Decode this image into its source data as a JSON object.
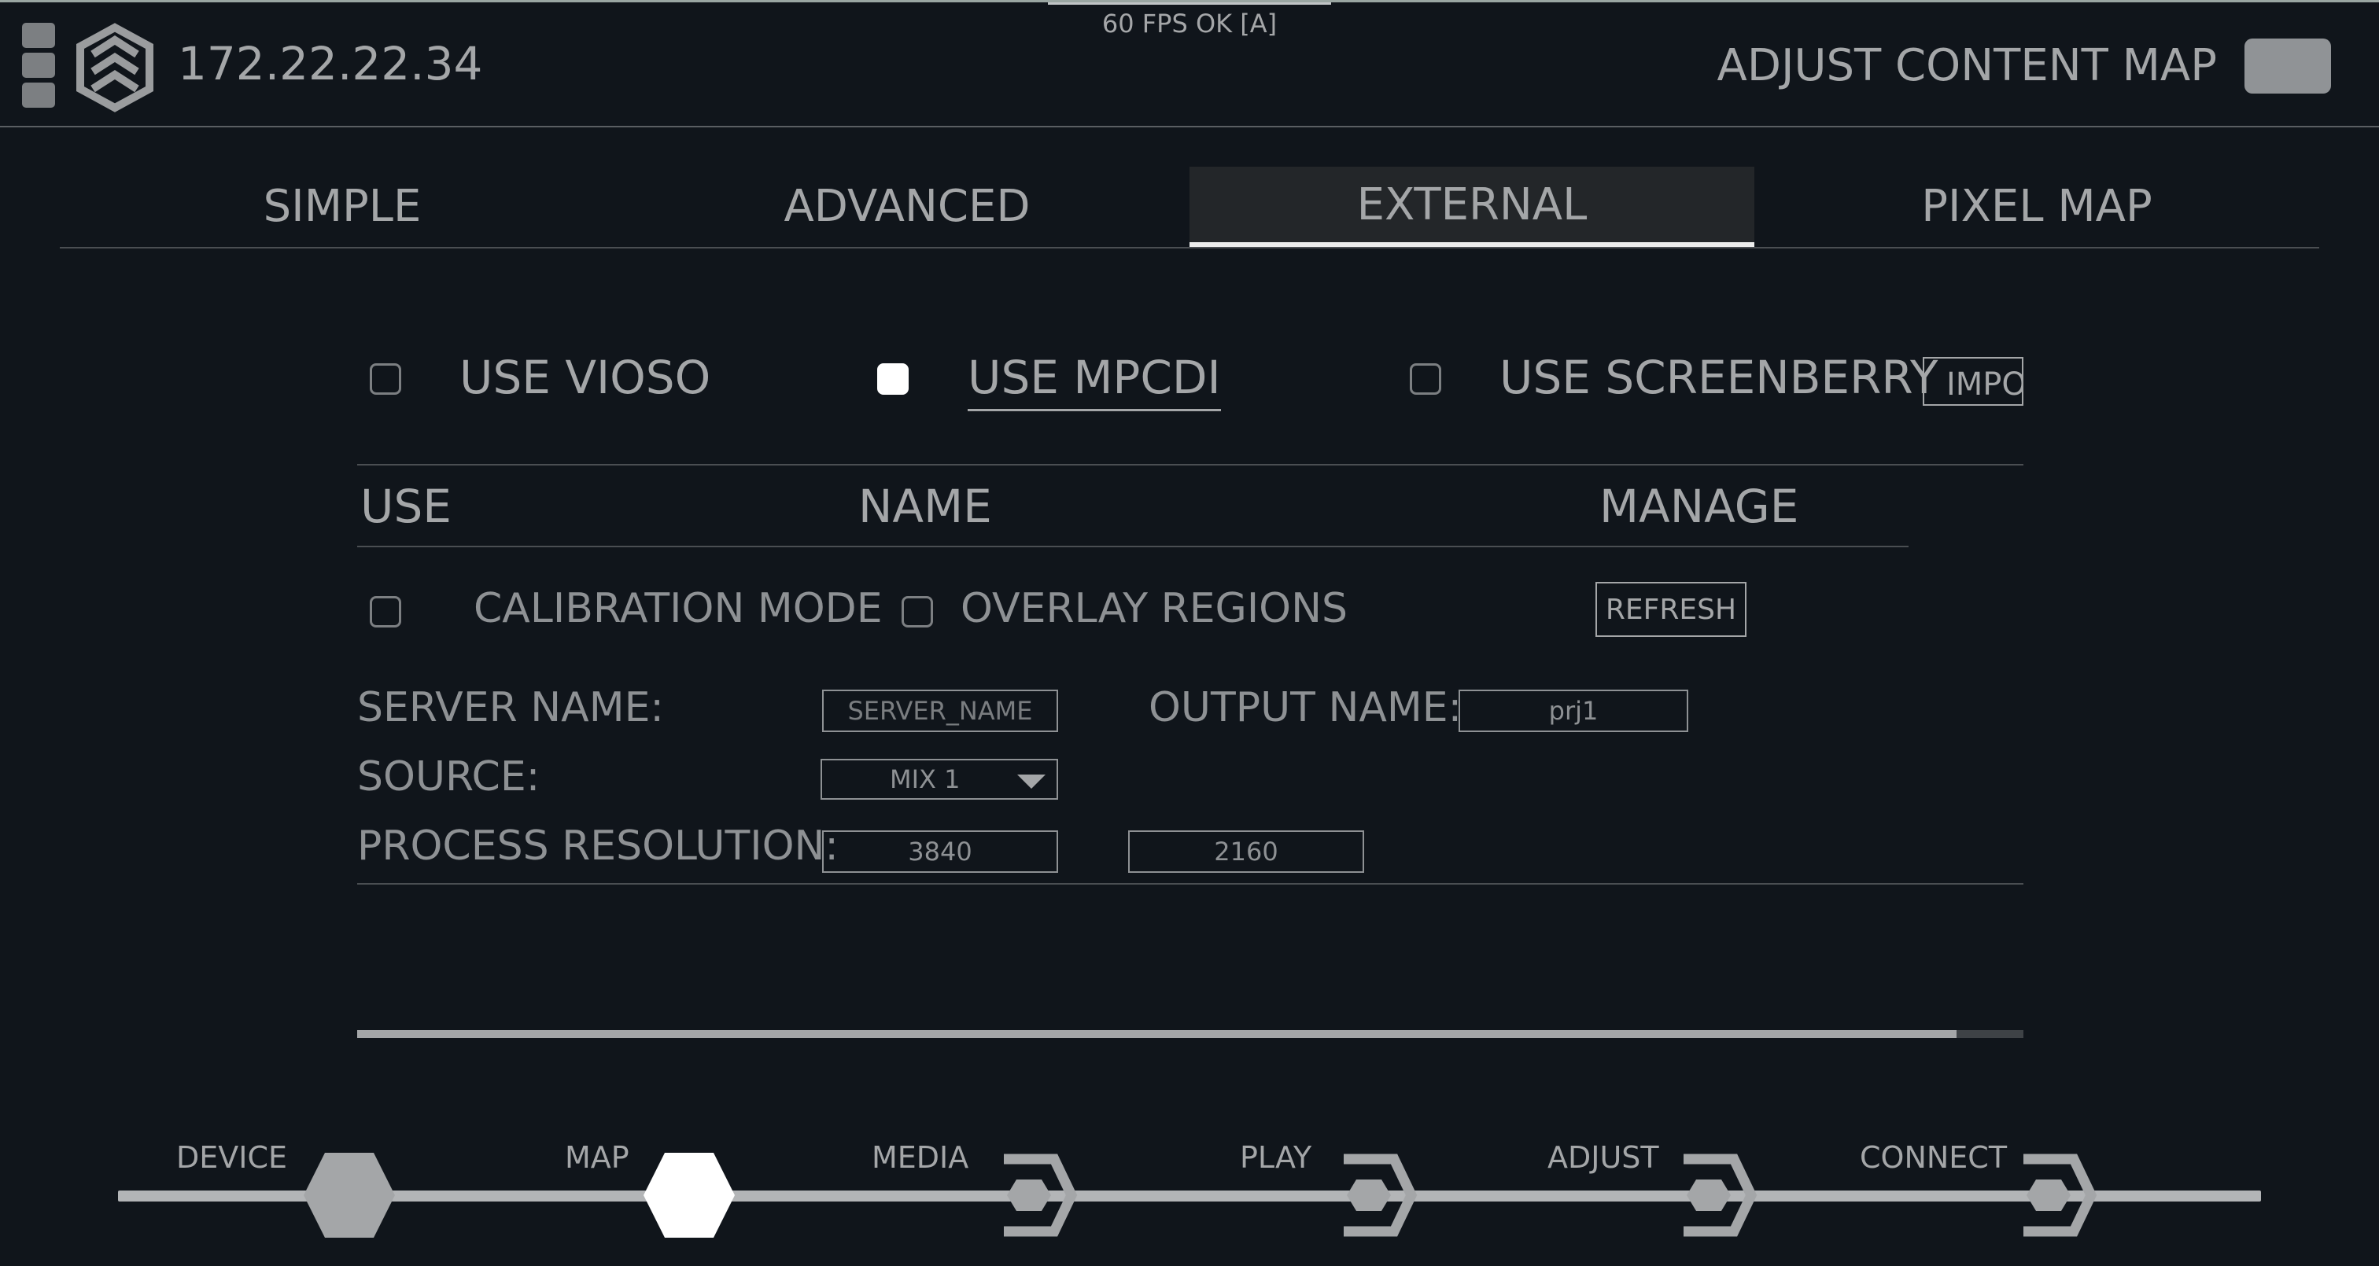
{
  "header": {
    "fps_status": "60 FPS OK [A]",
    "ip_address": "172.22.22.34",
    "adjust_content_map_label": "ADJUST CONTENT MAP",
    "adjust_content_map_enabled": false
  },
  "tabs": [
    {
      "label": "SIMPLE",
      "active": false
    },
    {
      "label": "ADVANCED",
      "active": false
    },
    {
      "label": "EXTERNAL",
      "active": true
    },
    {
      "label": "PIXEL MAP",
      "active": false
    }
  ],
  "external": {
    "options": [
      {
        "label": "USE VIOSO",
        "checked": false
      },
      {
        "label": "USE MPCDI",
        "checked": true
      },
      {
        "label": "USE SCREENBERRY",
        "checked": false
      }
    ],
    "import_label": "IMPORT",
    "table_headers": {
      "use": "USE",
      "name": "NAME",
      "manage": "MANAGE"
    },
    "calibration_mode_label": "CALIBRATION MODE",
    "calibration_mode_checked": false,
    "overlay_regions_label": "OVERLAY REGIONS",
    "overlay_regions_checked": false,
    "refresh_label": "REFRESH",
    "server_name_label": "SERVER NAME:",
    "server_name_placeholder": "SERVER_NAME",
    "output_name_label": "OUTPUT NAME:",
    "output_name_value": "prj1",
    "source_label": "SOURCE:",
    "source_value": "MIX 1",
    "process_resolution_label": "PROCESS RESOLUTION:",
    "resolution_width": "3840",
    "resolution_height": "2160",
    "progress_fraction": 0.96
  },
  "workflow": [
    {
      "label": "DEVICE",
      "state": "done"
    },
    {
      "label": "MAP",
      "state": "current"
    },
    {
      "label": "MEDIA",
      "state": "pending"
    },
    {
      "label": "PLAY",
      "state": "pending"
    },
    {
      "label": "ADJUST",
      "state": "pending"
    },
    {
      "label": "CONNECT",
      "state": "pending"
    }
  ],
  "colors": {
    "background": "#10151b",
    "text": "#a4a6a8",
    "active_tab_bg": "#232629",
    "accent_white": "#ffffff"
  }
}
